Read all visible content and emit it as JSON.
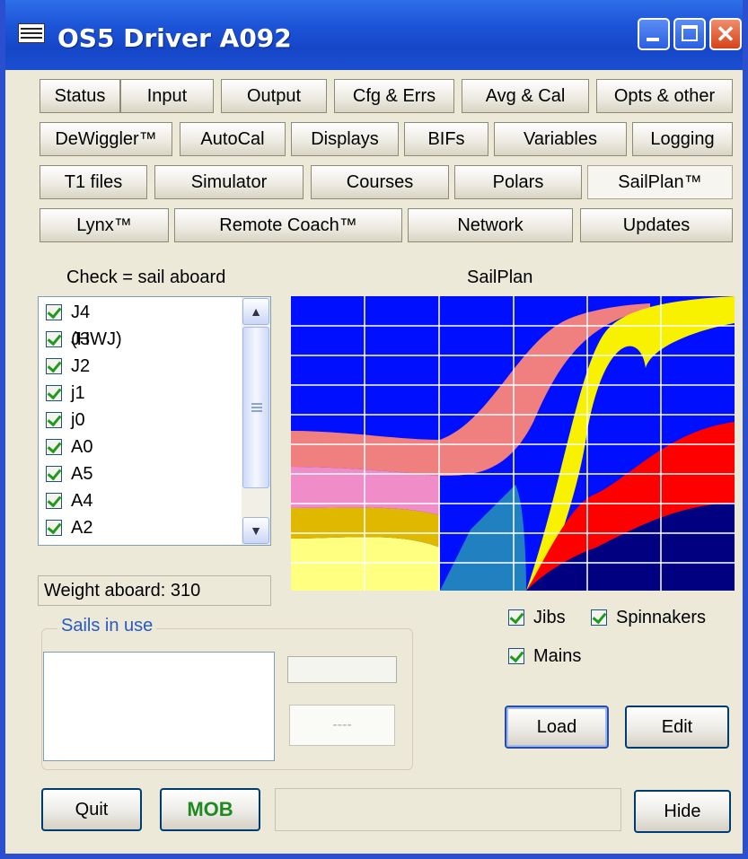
{
  "window": {
    "title": "OS5 Driver A092",
    "icon": "app-icon"
  },
  "tabs": [
    [
      "Status",
      "Input",
      "Output",
      "Cfg & Errs",
      "Avg & Cal",
      "Opts & other"
    ],
    [
      "DeWiggler™",
      "AutoCal",
      "Displays",
      "BIFs",
      "Variables",
      "Logging"
    ],
    [
      "T1 files",
      "Simulator",
      "Courses",
      "Polars",
      "SailPlan™"
    ],
    [
      "Lynx™",
      "Remote Coach™",
      "Network",
      "Updates"
    ]
  ],
  "active_tab": "SailPlan™",
  "sail_list": {
    "header": "Check = sail aboard",
    "items": [
      {
        "label": "J4 (HWJ)",
        "checked": true
      },
      {
        "label": "J3",
        "checked": true
      },
      {
        "label": "J2",
        "checked": true
      },
      {
        "label": "j1",
        "checked": true
      },
      {
        "label": "j0",
        "checked": true
      },
      {
        "label": "A0",
        "checked": true
      },
      {
        "label": "A5",
        "checked": true
      },
      {
        "label": "A4",
        "checked": true
      },
      {
        "label": "A2",
        "checked": true
      }
    ]
  },
  "weight": "Weight aboard: 310",
  "sails_in_use": {
    "title": "Sails in use",
    "dash_button": "----"
  },
  "sailplan": {
    "title": "SailPlan",
    "colors": {
      "background": "#0010ff",
      "grid": "#ffffff",
      "yellow": "#f8f200",
      "pink": "#f08080",
      "light_pink": "#f08cc8",
      "gold": "#e0b800",
      "pale_yellow": "#ffff80",
      "teal": "#2080c0",
      "red": "#ff0000",
      "navy": "#000080"
    }
  },
  "filters": {
    "jibs": "Jibs",
    "spinnakers": "Spinnakers",
    "mains": "Mains"
  },
  "buttons": {
    "load": "Load",
    "edit": "Edit",
    "quit": "Quit",
    "mob": "MOB",
    "hide": "Hide"
  }
}
